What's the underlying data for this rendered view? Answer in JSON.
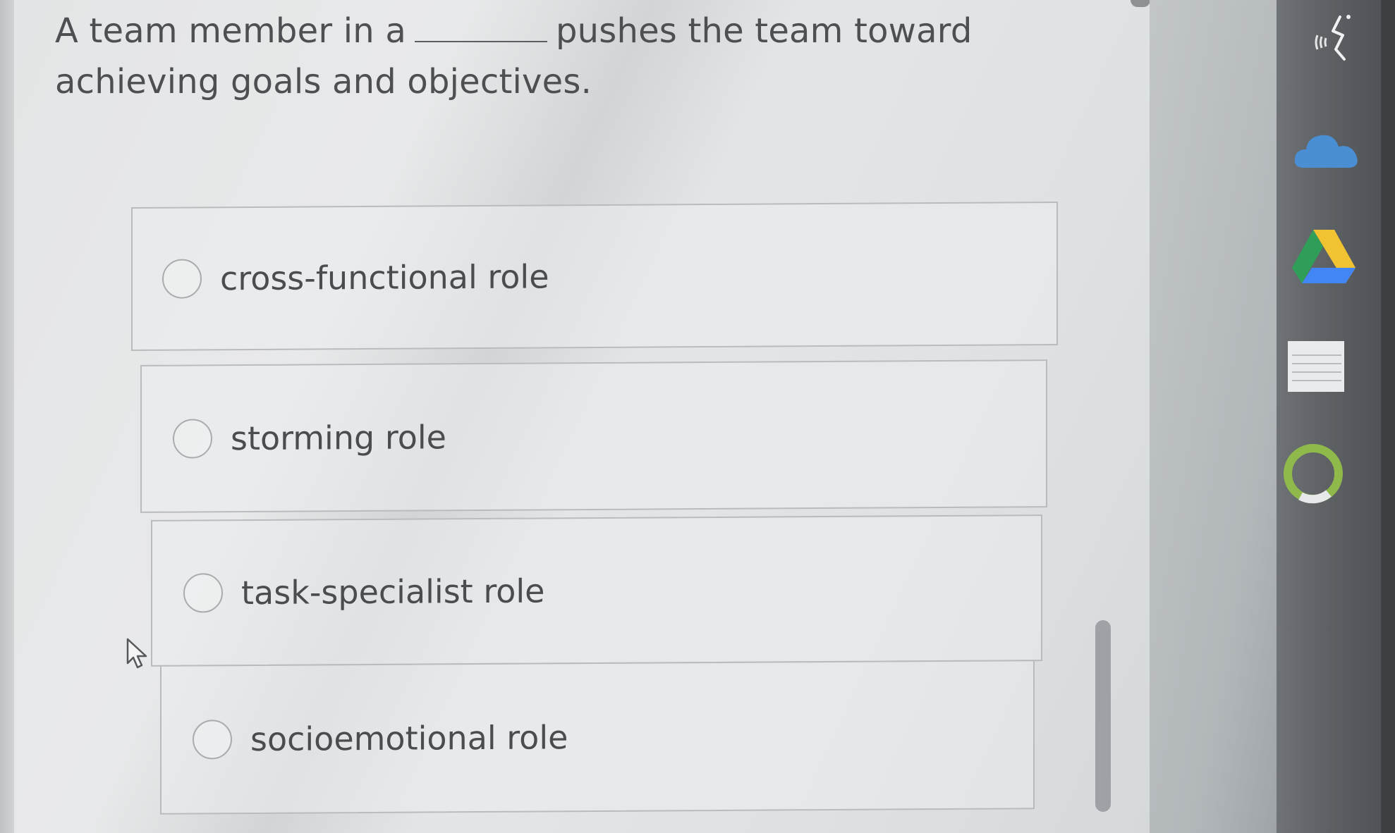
{
  "question": {
    "before_blank": "A team member in a",
    "after_blank": "pushes the team toward achieving goals and objectives."
  },
  "options": [
    {
      "label": "cross-functional role",
      "selected": false
    },
    {
      "label": "storming role",
      "selected": false
    },
    {
      "label": "task-specialist role",
      "selected": false
    },
    {
      "label": "socioemotional role",
      "selected": false
    }
  ],
  "taskbar_icons": [
    "wireless-display-icon",
    "onedrive-cloud-icon",
    "google-drive-icon",
    "notes-icon",
    "app-ring-icon"
  ],
  "colors": {
    "text": "#4d4f52",
    "border": "#b9bcbe",
    "taskbar": "#5e6265",
    "cloud": "#4a8fd4"
  }
}
